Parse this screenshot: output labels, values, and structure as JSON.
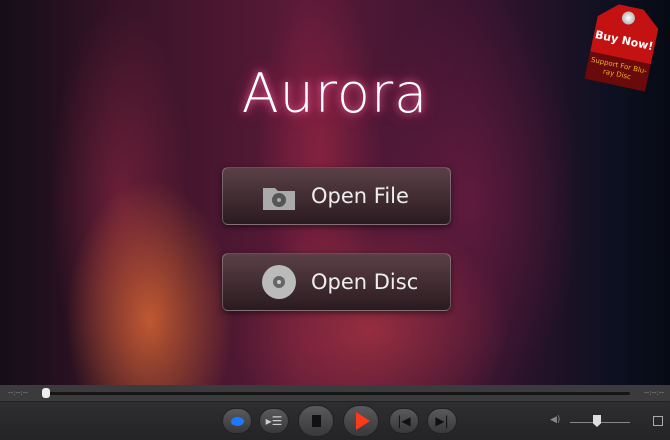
{
  "app": {
    "logo": "Aurora"
  },
  "buttons": {
    "open_file": "Open File",
    "open_disc": "Open Disc"
  },
  "promo": {
    "title": "Buy Now!",
    "subtitle": "Support For Blu-ray Disc"
  },
  "seek": {
    "elapsed": "--:--:--",
    "remaining": "--:--:--",
    "progress": 0
  },
  "volume": {
    "level": 0.45
  },
  "colors": {
    "accent": "#ff3a1a",
    "subtitle_blue": "#1a7aff",
    "promo_red": "#c41212"
  }
}
